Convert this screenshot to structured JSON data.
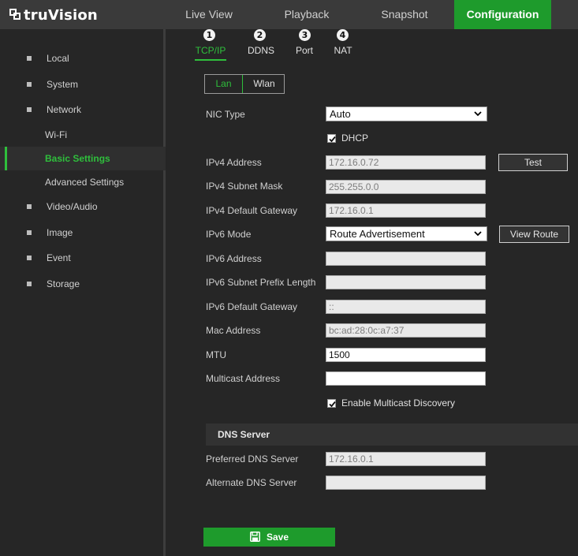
{
  "app": {
    "logo_text": "truVision"
  },
  "nav": {
    "tabs": [
      {
        "label": "Live View"
      },
      {
        "label": "Playback"
      },
      {
        "label": "Snapshot"
      },
      {
        "label": "Configuration",
        "active": true
      }
    ]
  },
  "sidebar": {
    "items": [
      {
        "label": "Local"
      },
      {
        "label": "System"
      },
      {
        "label": "Network"
      },
      {
        "label": "Wi-Fi"
      },
      {
        "label": "Basic Settings",
        "active": true
      },
      {
        "label": "Advanced Settings"
      },
      {
        "label": "Video/Audio"
      },
      {
        "label": "Image"
      },
      {
        "label": "Event"
      },
      {
        "label": "Storage"
      }
    ]
  },
  "subtabs": [
    {
      "label": "TCP/IP",
      "badge": "1",
      "active": true
    },
    {
      "label": "DDNS",
      "badge": "2"
    },
    {
      "label": "Port",
      "badge": "3"
    },
    {
      "label": "NAT",
      "badge": "4"
    }
  ],
  "iface_tabs": {
    "lan": "Lan",
    "wlan": "Wlan"
  },
  "form": {
    "nic_type": {
      "label": "NIC Type",
      "value": "Auto"
    },
    "dhcp": {
      "label": "DHCP",
      "checked": true
    },
    "ipv4_address": {
      "label": "IPv4 Address",
      "value": "172.16.0.72"
    },
    "test_button": "Test",
    "ipv4_subnet": {
      "label": "IPv4 Subnet Mask",
      "value": "255.255.0.0"
    },
    "ipv4_gateway": {
      "label": "IPv4 Default Gateway",
      "value": "172.16.0.1"
    },
    "ipv6_mode": {
      "label": "IPv6 Mode",
      "value": "Route Advertisement"
    },
    "view_route_button": "View Route",
    "ipv6_address": {
      "label": "IPv6 Address",
      "value": ""
    },
    "ipv6_prefix": {
      "label": "IPv6 Subnet Prefix Length",
      "value": ""
    },
    "ipv6_gateway": {
      "label": "IPv6 Default Gateway",
      "value": "::"
    },
    "mac_address": {
      "label": "Mac Address",
      "value": "bc:ad:28:0c:a7:37"
    },
    "mtu": {
      "label": "MTU",
      "value": "1500"
    },
    "multicast": {
      "label": "Multicast Address",
      "value": ""
    },
    "multicast_discovery": {
      "label": "Enable Multicast Discovery",
      "checked": true
    }
  },
  "dns": {
    "header": "DNS Server",
    "preferred": {
      "label": "Preferred DNS Server",
      "value": "172.16.0.1"
    },
    "alternate": {
      "label": "Alternate DNS Server",
      "value": ""
    }
  },
  "save_label": "Save",
  "colors": {
    "accent": "#1e9b2c",
    "accent_text": "#2fbf3c",
    "background": "#262626",
    "topbar": "#3a3a3a"
  }
}
